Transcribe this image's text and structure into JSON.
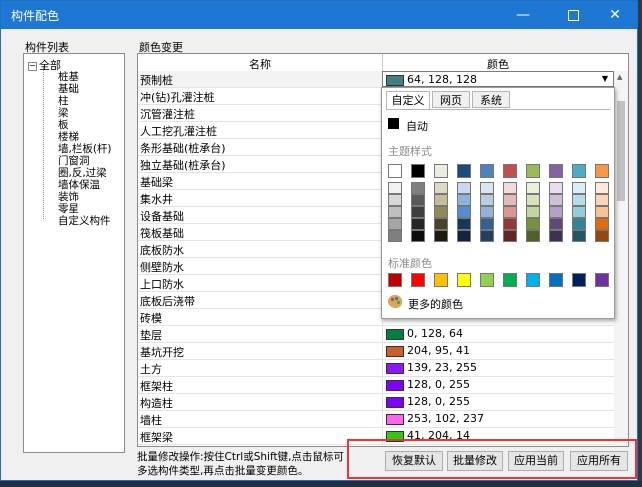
{
  "window": {
    "title": "构件配色",
    "min_glyph": "—",
    "close_glyph": "✕"
  },
  "left": {
    "label": "构件列表",
    "root": "全部",
    "items": [
      "桩基",
      "基础",
      "柱",
      "梁",
      "板",
      "楼梯",
      "墙,栏板(杆)",
      "门窗洞",
      "圈,反,过梁",
      "墙体保温",
      "装饰",
      "零星",
      "自定义构件"
    ]
  },
  "right": {
    "label": "颜色变更",
    "col_name": "名称",
    "col_color": "颜色",
    "rows": [
      {
        "name": "预制桩",
        "value": "64, 128, 128",
        "color": "#408080"
      },
      {
        "name": "冲(钻)孔灌注桩",
        "value": "",
        "color": ""
      },
      {
        "name": "沉管灌注桩",
        "value": "",
        "color": ""
      },
      {
        "name": "人工挖孔灌注桩",
        "value": "",
        "color": ""
      },
      {
        "name": "条形基础(桩承台)",
        "value": "",
        "color": ""
      },
      {
        "name": "独立基础(桩承台)",
        "value": "",
        "color": ""
      },
      {
        "name": "基础梁",
        "value": "",
        "color": ""
      },
      {
        "name": "集水井",
        "value": "",
        "color": ""
      },
      {
        "name": "设备基础",
        "value": "",
        "color": ""
      },
      {
        "name": "筏板基础",
        "value": "",
        "color": ""
      },
      {
        "name": "底板防水",
        "value": "",
        "color": ""
      },
      {
        "name": "侧壁防水",
        "value": "",
        "color": ""
      },
      {
        "name": "上口防水",
        "value": "",
        "color": ""
      },
      {
        "name": "底板后浇带",
        "value": "",
        "color": ""
      },
      {
        "name": "砖模",
        "value": "",
        "color": ""
      },
      {
        "name": "垫层",
        "value": "0, 128, 64",
        "color": "#008040"
      },
      {
        "name": "基坑开挖",
        "value": "204, 95, 41",
        "color": "#cc5f29"
      },
      {
        "name": "土方",
        "value": "139, 23, 255",
        "color": "#8b17ff"
      },
      {
        "name": "框架柱",
        "value": "128, 0, 255",
        "color": "#8000ff"
      },
      {
        "name": "构造柱",
        "value": "128, 0, 255",
        "color": "#8000ff"
      },
      {
        "name": "墙柱",
        "value": "253, 102, 237",
        "color": "#fd66ed"
      },
      {
        "name": "框架梁",
        "value": "41, 204, 14",
        "color": "#29cc0e"
      }
    ]
  },
  "popup": {
    "tabs": [
      "自定义",
      "网页",
      "系统"
    ],
    "auto_label": "自动",
    "theme_label": "主题样式",
    "standard_label": "标准颜色",
    "more_label": "更多的颜色",
    "theme_top": [
      "#ffffff",
      "#000000",
      "#eeece1",
      "#1f497d",
      "#4f81bd",
      "#c0504d",
      "#9bbb59",
      "#8064a2",
      "#4bacc6",
      "#f79646"
    ],
    "theme_shades": [
      [
        "#f2f2f2",
        "#7f7f7f",
        "#ddd9c3",
        "#c6d9f0",
        "#dbe5f1",
        "#f2dcdb",
        "#ebf1dd",
        "#e5e0ec",
        "#dbeef3",
        "#fdeada"
      ],
      [
        "#d8d8d8",
        "#595959",
        "#c4bd97",
        "#8db3e2",
        "#b8cce4",
        "#e5b9b7",
        "#d7e3bc",
        "#ccc1d9",
        "#b7dde8",
        "#fbd5b5"
      ],
      [
        "#bfbfbf",
        "#3f3f3f",
        "#938953",
        "#548dd4",
        "#95b3d7",
        "#d99694",
        "#c3d69b",
        "#b2a2c7",
        "#92cddc",
        "#fac08f"
      ],
      [
        "#a5a5a5",
        "#262626",
        "#494429",
        "#17365d",
        "#366092",
        "#953734",
        "#76923c",
        "#5f497a",
        "#31859b",
        "#e36c09"
      ],
      [
        "#7f7f7f",
        "#0c0c0c",
        "#1d1b10",
        "#0f243e",
        "#244061",
        "#632423",
        "#4f6128",
        "#3f3151",
        "#205867",
        "#974806"
      ]
    ],
    "standard": [
      "#c00000",
      "#ff0000",
      "#ffc000",
      "#ffff00",
      "#92d050",
      "#00b050",
      "#00b0f0",
      "#0070c0",
      "#002060",
      "#7030a0"
    ]
  },
  "hint": "批量修改操作:按住Ctrl或Shift键,点击鼠标可多选构件类型,再点击批量变更颜色。",
  "buttons": {
    "restore": "恢复默认",
    "batch": "批量修改",
    "apply_current": "应用当前",
    "apply_all": "应用所有"
  }
}
